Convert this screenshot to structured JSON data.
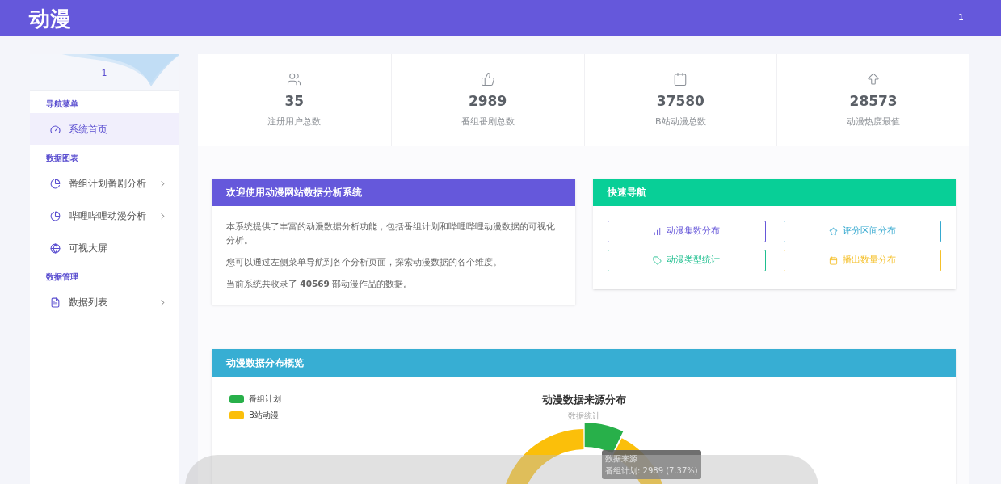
{
  "header": {
    "logo": "动漫",
    "user": "1"
  },
  "sidebar": {
    "user": "1",
    "sections": [
      {
        "title": "导航菜单",
        "items": [
          {
            "label": "系统首页",
            "selected": true,
            "has_children": false
          }
        ]
      },
      {
        "title": "数据图表",
        "items": [
          {
            "label": "番组计划番剧分析",
            "selected": false,
            "has_children": true
          },
          {
            "label": "哔哩哔哩动漫分析",
            "selected": false,
            "has_children": true
          },
          {
            "label": "可视大屏",
            "selected": false,
            "has_children": false
          }
        ]
      },
      {
        "title": "数据管理",
        "items": [
          {
            "label": "数据列表",
            "selected": false,
            "has_children": true
          }
        ]
      }
    ]
  },
  "stats": [
    {
      "value": "35",
      "label": "注册用户总数"
    },
    {
      "value": "2989",
      "label": "番组番剧总数"
    },
    {
      "value": "37580",
      "label": "B站动漫总数"
    },
    {
      "value": "28573",
      "label": "动漫热度最值"
    }
  ],
  "welcome": {
    "title": "欢迎使用动漫网站数据分析系统",
    "paragraphs": [
      "本系统提供了丰富的动漫数据分析功能，包括番组计划和哔哩哔哩动漫数据的可视化分析。",
      "您可以通过左侧菜单导航到各个分析页面，探索动漫数据的各个维度。",
      "当前系统共收录了 **40569** 部动漫作品的数据。"
    ]
  },
  "quick_nav": {
    "title": "快速导航",
    "buttons": [
      {
        "label": "动漫集数分布",
        "color": "#6657d9"
      },
      {
        "label": "评分区间分布",
        "color": "#36a9d0"
      },
      {
        "label": "动漫类型统计",
        "color": "#1fbf8f"
      },
      {
        "label": "播出数量分布",
        "color": "#f5c02a"
      }
    ]
  },
  "overview": {
    "title": "动漫数据分布概览",
    "subtitle": "数据统计",
    "chart_data": {
      "type": "donut",
      "title": "动漫数据来源分布",
      "legend": "top-left",
      "categories": [
        "番组计划",
        "B站动漫"
      ],
      "series": [
        {
          "name": "数据来源",
          "values": [
            7.37,
            92.63
          ]
        }
      ],
      "colors": [
        "#28b04a",
        "#fbbf0a"
      ]
    },
    "tooltip": {
      "text": "番组计划: 2989 (7.37%)"
    }
  }
}
